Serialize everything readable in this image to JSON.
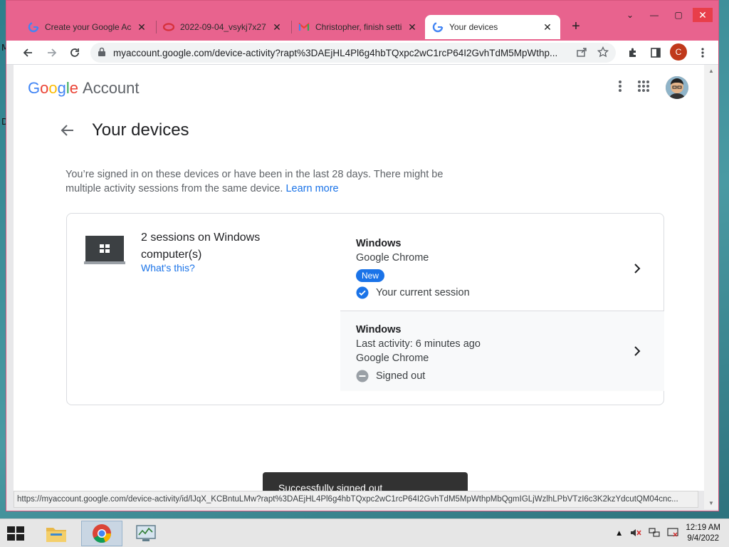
{
  "desktop": {
    "left_letters": [
      "M",
      "D"
    ]
  },
  "browser": {
    "tabs": [
      {
        "title": "Create your Google Acc",
        "favicon": "google-g-icon",
        "active": false
      },
      {
        "title": "2022-09-04_vsykj7x27 |",
        "favicon": "red-swirl-icon",
        "active": false
      },
      {
        "title": "Christopher, finish setti",
        "favicon": "gmail-icon",
        "active": false
      },
      {
        "title": "Your devices",
        "favicon": "google-g-icon",
        "active": true
      }
    ],
    "new_tab_label": "+",
    "url": "myaccount.google.com/device-activity?rapt%3DAEjHL4Pl6g4hbTQxpc2wC1rcP64I2GvhTdM5MpWthp...",
    "profile_initial": "C"
  },
  "page": {
    "logo_google": "Google",
    "logo_account": "Account",
    "title": "Your devices",
    "intro_text": "You’re signed in on these devices or have been in the last 28 days. There might be multiple activity sessions from the same device.",
    "learn_more": "Learn more",
    "device_group": {
      "title": "2 sessions on Windows computer(s)",
      "whats_this": "What's this?",
      "sessions": [
        {
          "os": "Windows",
          "browser": "Google Chrome",
          "badge": "New",
          "status": "Your current session"
        },
        {
          "os": "Windows",
          "activity": "Last activity: 6 minutes ago",
          "browser": "Google Chrome",
          "status": "Signed out"
        }
      ]
    },
    "snackbar": "Successfully signed out"
  },
  "status_bar_url": "https://myaccount.google.com/device-activity/id/lJqX_KCBntuLMw?rapt%3DAEjHL4Pl6g4hbTQxpc2wC1rcP64I2GvhTdM5MpWthpMbQgmIGLjWzlhLPbVTzI6c3K2kzYdcutQM04cnc...",
  "taskbar": {
    "clock_time": "12:19 AM",
    "clock_date": "9/4/2022"
  },
  "colors": {
    "chrome_frame": "#e8638e",
    "google_blue": "#1a73e8",
    "close_red": "#e83e4a"
  }
}
